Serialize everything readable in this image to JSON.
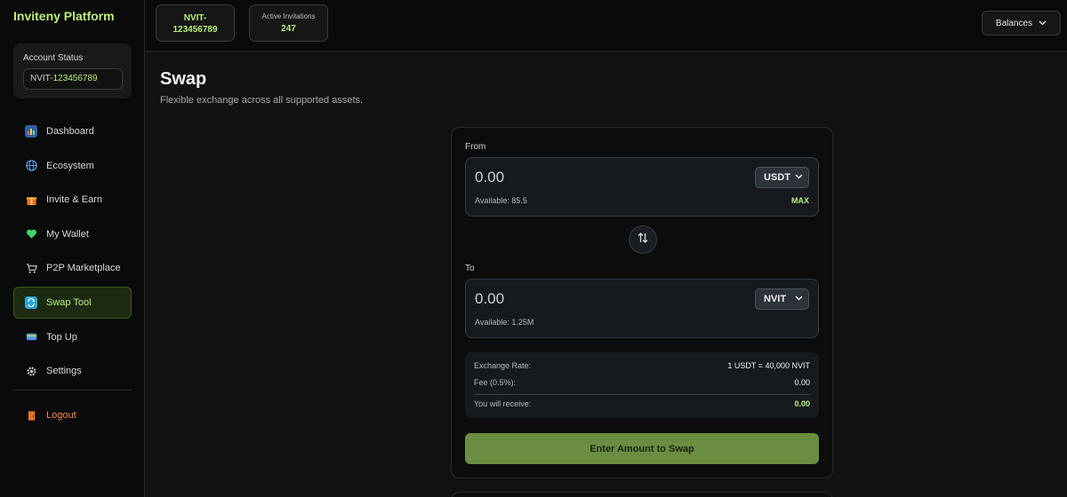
{
  "brand": "Inviteny Platform",
  "account_status": {
    "title": "Account Status",
    "id_prefix": "NVIT-",
    "id_number": "123456789"
  },
  "nav": {
    "items": [
      {
        "label": "Dashboard",
        "icon": "chart-icon",
        "color": "#5aa0ff"
      },
      {
        "label": "Ecosystem",
        "icon": "globe-icon",
        "color": "#3d8bd9"
      },
      {
        "label": "Invite & Earn",
        "icon": "gift-icon",
        "color": "#e9a13a"
      },
      {
        "label": "My Wallet",
        "icon": "heart-icon",
        "color": "#3ed46b"
      },
      {
        "label": "P2P Marketplace",
        "icon": "cart-icon",
        "color": "#bdbdbd"
      },
      {
        "label": "Swap Tool",
        "icon": "swap-icon",
        "color": "#2aa6d6",
        "active": true
      },
      {
        "label": "Top Up",
        "icon": "card-icon",
        "color": "#4a9be6"
      },
      {
        "label": "Settings",
        "icon": "gear-icon",
        "color": "#cfcfcf"
      }
    ],
    "logout": "Logout"
  },
  "topbar": {
    "id_line1": "NVIT-",
    "id_line2": "123456789",
    "invites_label": "Active Invitations",
    "invites_value": "247",
    "balances_label": "Balances"
  },
  "page": {
    "title": "Swap",
    "subtitle": "Flexible exchange across all supported assets."
  },
  "swap": {
    "from_label": "From",
    "from_amount": "0.00",
    "from_asset": "USDT",
    "from_available": "Available: 85.5",
    "max_label": "MAX",
    "to_label": "To",
    "to_amount": "0.00",
    "to_asset": "NVIT",
    "to_available": "Available: 1.25M",
    "rate_label": "Exchange Rate:",
    "rate_value": "1 USDT = 40,000 NVIT",
    "fee_label": "Fee (0.5%):",
    "fee_value": "0.00",
    "receive_label": "You will receive:",
    "receive_value": "0.00",
    "cta_label": "Enter Amount to Swap"
  },
  "colors": {
    "accent": "#b8ee7c",
    "cta": "#6a8d42",
    "logout": "#ff8a4a"
  }
}
